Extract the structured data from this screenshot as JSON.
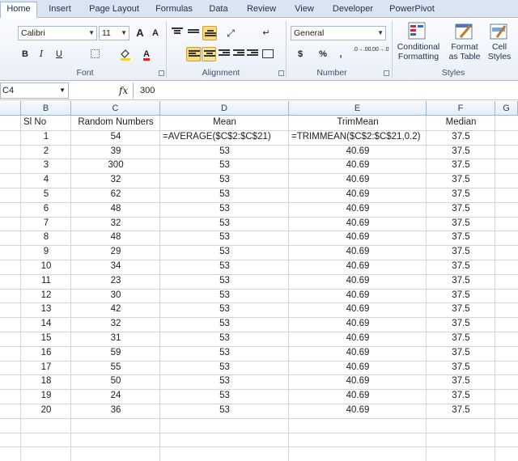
{
  "tabs": [
    "Home",
    "Insert",
    "Page Layout",
    "Formulas",
    "Data",
    "Review",
    "View",
    "Developer",
    "PowerPivot"
  ],
  "active_tab": "Home",
  "ribbon": {
    "font_name": "Calibri",
    "font_size": "11",
    "bold": "B",
    "italic": "I",
    "underline": "U",
    "grow_font": "A",
    "shrink_font": "A",
    "font_group": "Font",
    "alignment_group": "Alignment",
    "number_format": "General",
    "currency": "$",
    "percent": "%",
    "comma": ",",
    "increase_decimal": ".0→.00",
    "decrease_decimal": ".00→.0",
    "number_group": "Number",
    "conditional_formatting_1": "Conditional",
    "conditional_formatting_2": "Formatting",
    "format_table_1": "Format",
    "format_table_2": "as Table",
    "cell_styles_1": "Cell",
    "cell_styles_2": "Styles",
    "styles_group": "Styles",
    "accent_fill": "#fcd972",
    "font_color": "#e02020"
  },
  "formula_bar": {
    "name_box": "C4",
    "fx": "fx",
    "value": "300"
  },
  "column_headers": [
    "B",
    "C",
    "D",
    "E",
    "F",
    "G"
  ],
  "header_row": [
    "Sl No",
    "Random Numbers",
    "Mean",
    "TrimMean",
    "Median"
  ],
  "rows": [
    [
      "1",
      "54",
      "=AVERAGE($C$2:$C$21)",
      "=TRIMMEAN($C$2:$C$21,0.2)",
      "37.5"
    ],
    [
      "2",
      "39",
      "53",
      "40.69",
      "37.5"
    ],
    [
      "3",
      "300",
      "53",
      "40.69",
      "37.5"
    ],
    [
      "4",
      "32",
      "53",
      "40.69",
      "37.5"
    ],
    [
      "5",
      "62",
      "53",
      "40.69",
      "37.5"
    ],
    [
      "6",
      "48",
      "53",
      "40.69",
      "37.5"
    ],
    [
      "7",
      "32",
      "53",
      "40.69",
      "37.5"
    ],
    [
      "8",
      "48",
      "53",
      "40.69",
      "37.5"
    ],
    [
      "9",
      "29",
      "53",
      "40.69",
      "37.5"
    ],
    [
      "10",
      "34",
      "53",
      "40.69",
      "37.5"
    ],
    [
      "11",
      "23",
      "53",
      "40.69",
      "37.5"
    ],
    [
      "12",
      "30",
      "53",
      "40.69",
      "37.5"
    ],
    [
      "13",
      "42",
      "53",
      "40.69",
      "37.5"
    ],
    [
      "14",
      "32",
      "53",
      "40.69",
      "37.5"
    ],
    [
      "15",
      "31",
      "53",
      "40.69",
      "37.5"
    ],
    [
      "16",
      "59",
      "53",
      "40.69",
      "37.5"
    ],
    [
      "17",
      "55",
      "53",
      "40.69",
      "37.5"
    ],
    [
      "18",
      "50",
      "53",
      "40.69",
      "37.5"
    ],
    [
      "19",
      "24",
      "53",
      "40.69",
      "37.5"
    ],
    [
      "20",
      "36",
      "53",
      "40.69",
      "37.5"
    ]
  ]
}
